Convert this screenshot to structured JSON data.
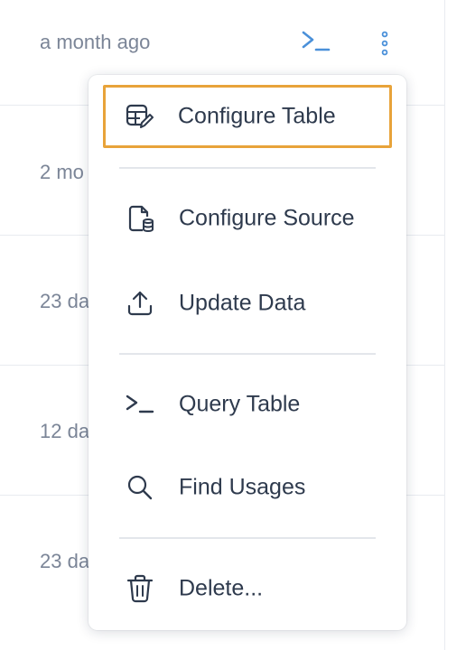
{
  "rows": [
    {
      "time": "a month ago"
    },
    {
      "time": "2 mo"
    },
    {
      "time": "23 da"
    },
    {
      "time": "12 da"
    },
    {
      "time": "23 da"
    }
  ],
  "row_actions": {
    "query_icon": "terminal-icon",
    "more_icon": "more-vertical-icon"
  },
  "menu": {
    "items": [
      {
        "label": "Configure Table",
        "icon": "table-edit-icon",
        "focused": true
      },
      {
        "label": "Configure Source",
        "icon": "file-database-icon"
      },
      {
        "label": "Update Data",
        "icon": "upload-icon"
      },
      {
        "label": "Query Table",
        "icon": "terminal-icon"
      },
      {
        "label": "Find Usages",
        "icon": "search-icon"
      },
      {
        "label": "Delete...",
        "icon": "trash-icon"
      }
    ]
  },
  "colors": {
    "accent": "#4a90d9",
    "focus_outline": "#e8a33a",
    "menu_text": "#2e3a4d",
    "muted_text": "#7b8597"
  }
}
